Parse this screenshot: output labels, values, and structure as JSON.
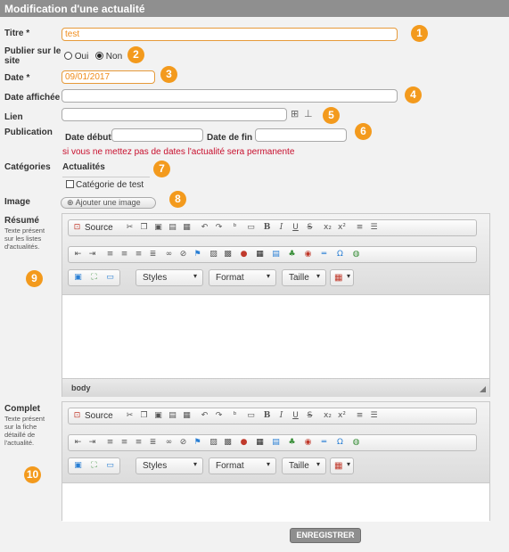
{
  "header": {
    "title": "Modification d'une actualité"
  },
  "labels": {
    "titre": "Titre *",
    "publier_line1": "Publier sur le",
    "publier_line2": "site",
    "date": "Date *",
    "date_affichee": "Date affichée",
    "lien": "Lien",
    "publication": "Publication",
    "date_debut": "Date début",
    "date_fin": "Date de fin",
    "categories": "Catégories",
    "image": "Image",
    "resume": "Résumé",
    "resume_help": [
      "Texte présent",
      "sur les listes",
      "d'actualités."
    ],
    "complet": "Complet",
    "complet_help": [
      "Texte présent",
      "sur la fiche",
      "détaillé de",
      "l'actualité."
    ]
  },
  "fields": {
    "titre_value": "test",
    "date_value": "09/01/2017",
    "date_affichee_value": "",
    "lien_value": "",
    "date_debut_value": "",
    "date_fin_value": ""
  },
  "publier": {
    "oui": "Oui",
    "non": "Non",
    "selected": "Non"
  },
  "publication_hint": "si vous ne mettez pas de dates l'actualité sera permanente",
  "categories": {
    "heading": "Actualités",
    "item": "Catégorie de test",
    "checked": false
  },
  "image_button": "Ajouter une image",
  "editor": {
    "source_label": "Source",
    "styles": "Styles",
    "format": "Format",
    "taille": "Taille",
    "status_path": "body"
  },
  "save_button": "ENREGISTRER",
  "badges": [
    "1",
    "2",
    "3",
    "4",
    "5",
    "6",
    "7",
    "8",
    "9",
    "10"
  ],
  "colors": {
    "accent": "#f39a1d",
    "header": "#8f8f8f",
    "warning": "#c8102e",
    "date_text": "#f08c1a"
  }
}
